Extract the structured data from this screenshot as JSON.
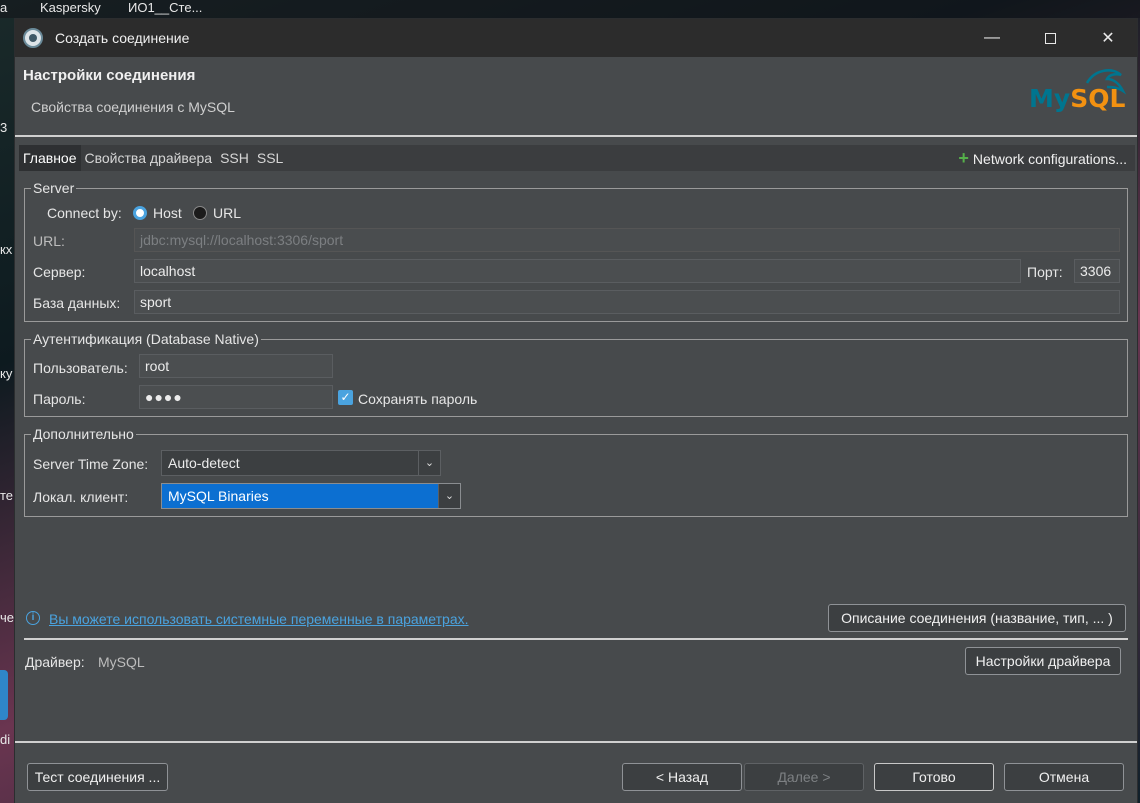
{
  "desktop": {
    "taskbar_items": [
      "а",
      "Kaspersky",
      "ИО1__Сте..."
    ],
    "edge_fragments": [
      "3",
      "кх",
      "ку",
      "те",
      "че",
      "di"
    ]
  },
  "window": {
    "title": "Создать соединение",
    "minimize_symbol": "—",
    "close_symbol": "✕"
  },
  "header": {
    "title": "Настройки соединения",
    "subtitle": "Свойства соединения с MySQL",
    "logo_text": "MySQL",
    "logo_colors": {
      "my": "#00758f",
      "sql": "#f29111"
    }
  },
  "tabs": [
    {
      "label": "Главное",
      "active": true
    },
    {
      "label": "Свойства драйвера",
      "active": false
    },
    {
      "label": "SSH",
      "active": false
    },
    {
      "label": "SSL",
      "active": false
    }
  ],
  "network_configurations": {
    "icon": "+",
    "label": "Network configurations..."
  },
  "server": {
    "legend": "Server",
    "connect_by_label": "Connect by:",
    "option_host": "Host",
    "option_url": "URL",
    "selected": "Host",
    "url_label": "URL:",
    "url_value": "jdbc:mysql://localhost:3306/sport",
    "server_label": "Сервер:",
    "server_value": "localhost",
    "port_label": "Порт:",
    "port_value": "3306",
    "database_label": "База данных:",
    "database_value": "sport"
  },
  "auth": {
    "legend": "Аутентификация (Database Native)",
    "user_label": "Пользователь:",
    "user_value": "root",
    "password_label": "Пароль:",
    "password_value": "●●●●",
    "save_password_label": "Сохранять пароль",
    "save_password_checked": true
  },
  "additional": {
    "legend": "Дополнительно",
    "timezone_label": "Server Time Zone:",
    "timezone_value": "Auto-detect",
    "local_client_label": "Локал. клиент:",
    "local_client_value": "MySQL Binaries"
  },
  "info": {
    "icon": "i",
    "link_text": "Вы можете использовать системные переменные в параметрах.",
    "description_button": "Описание соединения (название, тип, ... )"
  },
  "driver": {
    "label": "Драйвер:",
    "value": "MySQL",
    "settings_button": "Настройки драйвера"
  },
  "footer": {
    "test_button": "Тест соединения ...",
    "back_button": "< Назад",
    "next_button": "Далее >",
    "finish_button": "Готово",
    "cancel_button": "Отмена"
  }
}
